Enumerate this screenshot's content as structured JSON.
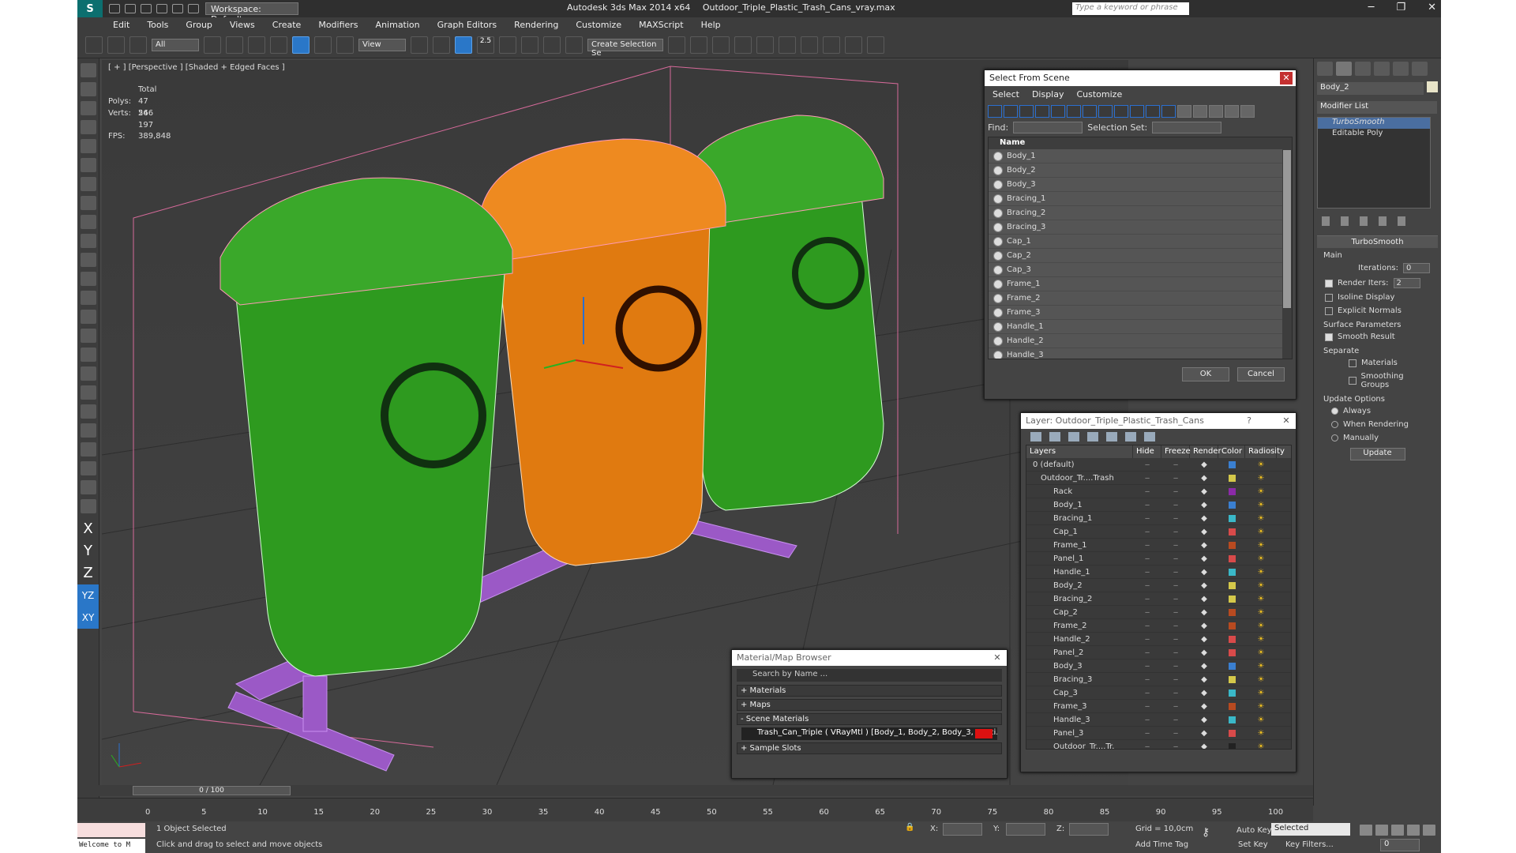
{
  "titlebar": {
    "workspace": "Workspace: Default",
    "app_title": "Autodesk 3ds Max  2014 x64",
    "file_name": "Outdoor_Triple_Plastic_Trash_Cans_vray.max",
    "search_placeholder": "Type a keyword or phrase",
    "minimize": "─",
    "restore": "❐",
    "close": "✕"
  },
  "menu": [
    "Edit",
    "Tools",
    "Group",
    "Views",
    "Create",
    "Modifiers",
    "Animation",
    "Graph Editors",
    "Rendering",
    "Customize",
    "MAXScript",
    "Help"
  ],
  "toolbar": {
    "selection_filter": "All",
    "ref_coord": "View",
    "snap_value": "2.5",
    "selection_set_placeholder": "Create Selection Se"
  },
  "viewport": {
    "label": "[ + ] [Perspective ] [Shaded + Edged Faces ]",
    "stats": {
      "total_label": "Total",
      "polys_label": "Polys:",
      "polys": "47 566",
      "verts_label": "Verts:",
      "verts": "24 197",
      "fps_label": "FPS:",
      "fps": "389,848"
    }
  },
  "left_axes": [
    "X",
    "Y",
    "Z",
    "YZ",
    "XY"
  ],
  "command_panel": {
    "object_name": "Body_2",
    "modifier_list": "Modifier List",
    "stack": [
      "TurboSmooth",
      "Editable Poly"
    ],
    "rollout_title": "TurboSmooth",
    "main_label": "Main",
    "iterations_label": "Iterations:",
    "iterations": "0",
    "render_iters_label": "Render Iters:",
    "render_iters": "2",
    "isoline": "Isoline Display",
    "explicit_normals": "Explicit Normals",
    "surface_params": "Surface Parameters",
    "smooth_result": "Smooth Result",
    "separate": "Separate",
    "materials": "Materials",
    "smoothing_groups": "Smoothing Groups",
    "update_options": "Update Options",
    "always": "Always",
    "when_rendering": "When Rendering",
    "manually": "Manually",
    "update_btn": "Update"
  },
  "select_from_scene": {
    "title": "Select From Scene",
    "menu": [
      "Select",
      "Display",
      "Customize"
    ],
    "find_label": "Find:",
    "selection_set_label": "Selection Set:",
    "column_name": "Name",
    "items": [
      "Body_1",
      "Body_2",
      "Body_3",
      "Bracing_1",
      "Bracing_2",
      "Bracing_3",
      "Cap_1",
      "Cap_2",
      "Cap_3",
      "Frame_1",
      "Frame_2",
      "Frame_3",
      "Handle_1",
      "Handle_2",
      "Handle_3"
    ],
    "ok": "OK",
    "cancel": "Cancel"
  },
  "layer_dialog": {
    "title": "Layer: Outdoor_Triple_Plastic_Trash_Cans",
    "help": "?",
    "columns": [
      "Layers",
      "Hide",
      "Freeze",
      "Render",
      "Color",
      "Radiosity"
    ],
    "rows": [
      {
        "name": "0 (default)",
        "level": "top",
        "color": "#3a7fd0"
      },
      {
        "name": "Outdoor_Tr....Trash",
        "level": "mid",
        "color": "#d4c84a"
      },
      {
        "name": "Rack",
        "level": "child",
        "color": "#8b2aa8"
      },
      {
        "name": "Body_1",
        "level": "child",
        "color": "#3a7fd0"
      },
      {
        "name": "Bracing_1",
        "level": "child",
        "color": "#3ab8c8"
      },
      {
        "name": "Cap_1",
        "level": "child",
        "color": "#d84a4a"
      },
      {
        "name": "Frame_1",
        "level": "child",
        "color": "#b84a20"
      },
      {
        "name": "Panel_1",
        "level": "child",
        "color": "#d84a4a"
      },
      {
        "name": "Handle_1",
        "level": "child",
        "color": "#3ab8c8"
      },
      {
        "name": "Body_2",
        "level": "child",
        "color": "#d4c84a"
      },
      {
        "name": "Bracing_2",
        "level": "child",
        "color": "#d4c84a"
      },
      {
        "name": "Cap_2",
        "level": "child",
        "color": "#b84a20"
      },
      {
        "name": "Frame_2",
        "level": "child",
        "color": "#b84a20"
      },
      {
        "name": "Handle_2",
        "level": "child",
        "color": "#d84a4a"
      },
      {
        "name": "Panel_2",
        "level": "child",
        "color": "#d84a4a"
      },
      {
        "name": "Body_3",
        "level": "child",
        "color": "#3a7fd0"
      },
      {
        "name": "Bracing_3",
        "level": "child",
        "color": "#d4c84a"
      },
      {
        "name": "Cap_3",
        "level": "child",
        "color": "#3ab8c8"
      },
      {
        "name": "Frame_3",
        "level": "child",
        "color": "#b84a20"
      },
      {
        "name": "Handle_3",
        "level": "child",
        "color": "#3ab8c8"
      },
      {
        "name": "Panel_3",
        "level": "child",
        "color": "#d84a4a"
      },
      {
        "name": "Outdoor_Tr....Tr.",
        "level": "child",
        "color": "#222222"
      }
    ]
  },
  "material_browser": {
    "title": "Material/Map Browser",
    "search": "Search by Name ...",
    "materials": "+ Materials",
    "maps": "+ Maps",
    "scene_materials": "- Scene Materials",
    "scene_item": "Trash_Can_Triple  ( VRayMtl ) [Body_1, Body_2, Body_3, Braci...",
    "sample_slots": "+ Sample Slots"
  },
  "timeline": {
    "slider": "0 / 100",
    "ticks": [
      "0",
      "5",
      "10",
      "15",
      "20",
      "25",
      "30",
      "35",
      "40",
      "45",
      "50",
      "55",
      "60",
      "65",
      "70",
      "75",
      "80",
      "85",
      "90",
      "95",
      "100"
    ]
  },
  "status": {
    "listener_top": "",
    "listener_bottom": "Welcome to M",
    "selected": "1 Object Selected",
    "prompt": "Click and drag to select and move objects",
    "x_label": "X:",
    "y_label": "Y:",
    "z_label": "Z:",
    "grid": "Grid = 10,0cm",
    "add_time_tag": "Add Time Tag",
    "auto_key": "Auto Key",
    "set_key": "Set Key",
    "selected_dd": "Selected",
    "key_filters": "Key Filters...",
    "frame": "0"
  },
  "colors": {
    "accent": "#2a77c8",
    "green_can": "#2e9a1f",
    "orange_can": "#e07a10",
    "rack": "#9b59c6"
  }
}
